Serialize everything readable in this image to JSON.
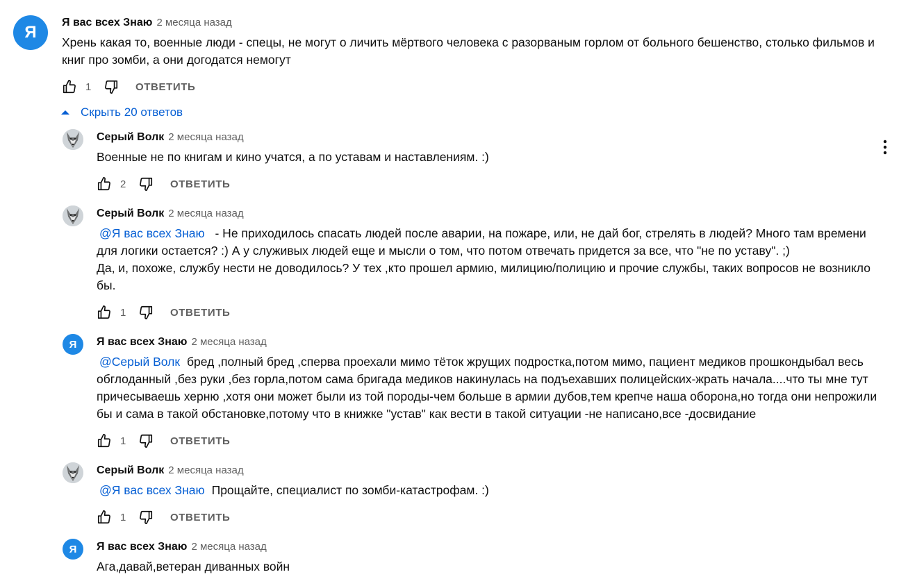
{
  "top_comment": {
    "avatar_letter": "Я",
    "author": "Я вас всех Знаю",
    "time": "2 месяца назад",
    "text": "Хрень какая то, военные люди  - спецы, не могут о личить мёртвого человека с разорваным горлом от больного бешенство, столько фильмов и книг про зомби, а они догодатся немогут",
    "likes": "1",
    "reply_label": "ОТВЕТИТЬ"
  },
  "replies_toggle": {
    "label": "Скрыть 20 ответов",
    "icon": "chevron-up-icon"
  },
  "replies": [
    {
      "avatar": "wolf-avatar",
      "author": "Серый Волк",
      "time": "2 месяца назад",
      "mention": "",
      "text": "Военные не по книгам и кино учатся, а по уставам и наставлениям. :)",
      "likes": "2",
      "reply_label": "ОТВЕТИТЬ"
    },
    {
      "avatar": "wolf-avatar",
      "author": "Серый Волк",
      "time": "2 месяца назад",
      "mention": "@Я вас всех Знаю",
      "text": " - Не приходилось спасать людей после аварии, на пожаре, или, не дай бог, стрелять в людей? Много там времени для логики остается? :) А у служивых людей еще и мысли о том, что потом отвечать придется за все, что \"не по уставу\".  ;)",
      "text2": "Да, и, похоже, службу нести не доводилось? У тех ,кто прошел армию, милицию/полицию и прочие службы, таких вопросов не возникло бы.",
      "likes": "1",
      "reply_label": "ОТВЕТИТЬ"
    },
    {
      "avatar_letter": "Я",
      "author": "Я вас всех Знаю",
      "time": "2 месяца назад",
      "mention": "@Серый Волк",
      "text": "бред ,полный бред ,сперва проехали мимо тёток жрущих подростка,потом мимо, пациент медиков прошкондыбал весь обглоданный ,без руки ,без горла,потом сама бригада медиков накинулась на подъехавших полицейских-жрать начала....что ты мне тут причесываешь херню ,хотя они может были из той породы-чем больше в армии дубов,тем крепче наша оборона,но тогда они непрожили бы и сама в такой обстановке,потому что в книжке \"устав\" как вести в такой ситуации -не написано,все -досвидание",
      "likes": "1",
      "reply_label": "ОТВЕТИТЬ"
    },
    {
      "avatar": "wolf-avatar",
      "author": "Серый Волк",
      "time": "2 месяца назад",
      "mention": "@Я вас всех Знаю",
      "text": "Прощайте, специалист по зомби-катастрофам. :)",
      "likes": "1",
      "reply_label": "ОТВЕТИТЬ"
    },
    {
      "avatar_letter": "Я",
      "author": "Я вас всех Знаю",
      "time": "2 месяца назад",
      "mention": "",
      "text": "Ага,давай,ветеран диванных войн"
    }
  ],
  "menu_icon": "more-vertical-icon",
  "colors": {
    "link": "#065fd4",
    "avatar_bg": "#1e88e5",
    "secondary_text": "#606060"
  }
}
